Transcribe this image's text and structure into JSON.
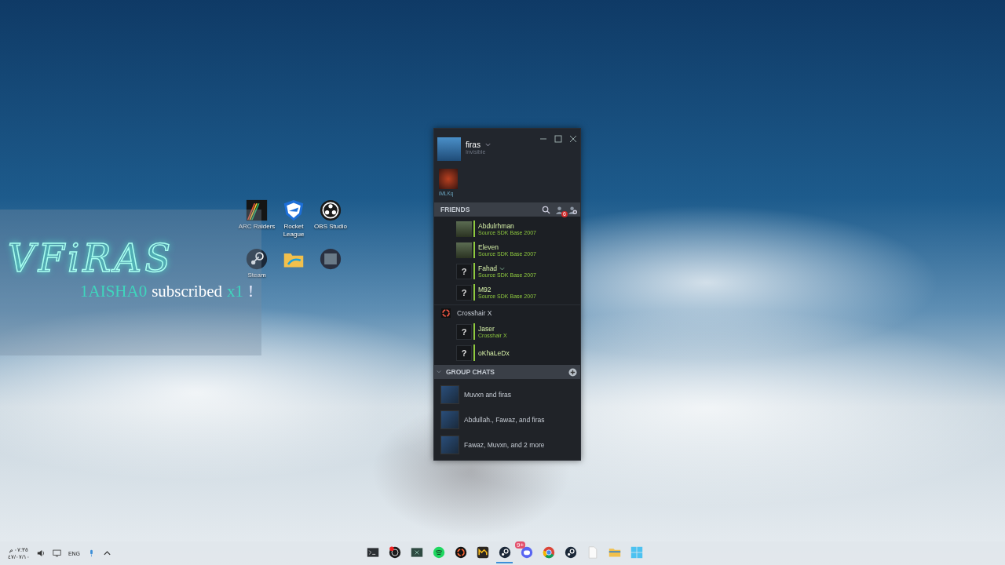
{
  "desktop_icons": [
    {
      "label": "ARC Raiders",
      "kind": "arc"
    },
    {
      "label": "Rocket League",
      "kind": "rocket"
    },
    {
      "label": "OBS Studio",
      "kind": "obs"
    },
    {
      "label": "Steam",
      "kind": "steam"
    },
    {
      "kind": "folder"
    },
    {
      "kind": "mod"
    }
  ],
  "stream_overlay": {
    "logo": "VFiRAS",
    "alert": {
      "user": "1AISHA0",
      "action": "subscribed",
      "count": "x1",
      "mark": "!"
    }
  },
  "friends_window": {
    "profile": {
      "name": "firas",
      "status": "Invisible"
    },
    "favorite": {
      "name": "iMLKq"
    },
    "friends_header": {
      "title": "FRIENDS",
      "requests_badge": "6"
    },
    "friends": [
      {
        "name": "Abdulrhman",
        "game": "Source SDK Base 2007",
        "menu": false
      },
      {
        "name": "Eleven",
        "game": "Source SDK Base 2007",
        "menu": false
      },
      {
        "name": "Fahad",
        "game": "Source SDK Base 2007",
        "avatar_glyph": "?",
        "menu": true
      },
      {
        "name": "M92",
        "game": "Source SDK Base 2007",
        "avatar_glyph": "?",
        "menu": false
      }
    ],
    "game_group": {
      "title": "Crosshair X",
      "members": [
        {
          "name": "Jaser",
          "game": "Crosshair X",
          "avatar_glyph": "?",
          "menu": false
        },
        {
          "name": "oKhaLeDx",
          "avatar_glyph": "?",
          "menu": false
        }
      ]
    },
    "group_chats": {
      "title": "GROUP CHATS",
      "expanded": true,
      "items": [
        {
          "name": "Muvxn and firas"
        },
        {
          "name": "Abdullah., Fawaz, and firas"
        },
        {
          "name": "Fawaz, Muvxn, and 2 more"
        }
      ]
    }
  },
  "taskbar": {
    "time": "٠٧:٣٥ م",
    "date": "٤٧/٠٧/١٠",
    "language": "ENG",
    "apps": [
      {
        "kind": "terminal",
        "selected": false
      },
      {
        "kind": "obs",
        "selected": false
      },
      {
        "kind": "xbox",
        "selected": false
      },
      {
        "kind": "spotify",
        "selected": false
      },
      {
        "kind": "crosshair",
        "selected": false
      },
      {
        "kind": "medal",
        "selected": false
      },
      {
        "kind": "steam",
        "selected": true
      },
      {
        "kind": "discord",
        "selected": false,
        "badge": "9+"
      },
      {
        "kind": "chrome",
        "selected": false
      },
      {
        "kind": "steam",
        "selected": false
      },
      {
        "kind": "file",
        "selected": false
      },
      {
        "kind": "folder",
        "selected": false
      },
      {
        "kind": "windows",
        "selected": false
      }
    ]
  }
}
